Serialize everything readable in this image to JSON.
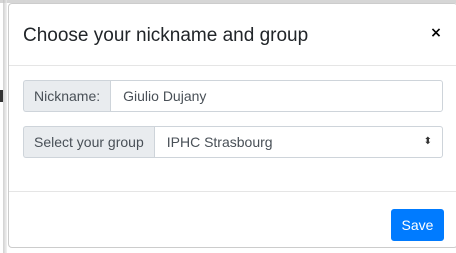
{
  "modal": {
    "title": "Choose your nickname and group",
    "close_label": "×"
  },
  "form": {
    "nickname": {
      "label": "Nickname:",
      "value": "Giulio Dujany"
    },
    "group": {
      "label": "Select your group",
      "selected": "IPHC Strasbourg",
      "arrow": "⬍"
    }
  },
  "footer": {
    "save_label": "Save"
  },
  "colors": {
    "accent": "#007bff",
    "addon_bg": "#e9ecef",
    "border": "#ced4da"
  }
}
